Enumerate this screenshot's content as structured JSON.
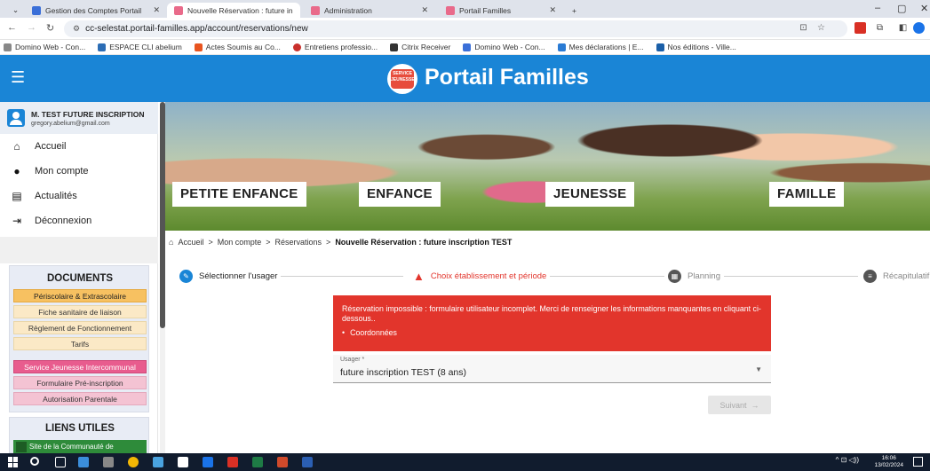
{
  "browser": {
    "tabs": [
      {
        "label": "Gestion des Comptes Portail",
        "favicon_color": "#3a6fd8",
        "active": false
      },
      {
        "label": "Nouvelle Réservation : future in",
        "favicon_color": "#e96a8a",
        "active": true
      },
      {
        "label": "Administration",
        "favicon_color": "#e96a8a",
        "active": false
      },
      {
        "label": "Portail Familles",
        "favicon_color": "#e96a8a",
        "active": false
      }
    ],
    "new_tab_label": "+",
    "url": "cc-selestat.portail-familles.app/account/reservations/new",
    "bookmarks": [
      {
        "label": "Domino Web - Con...",
        "color": "#888"
      },
      {
        "label": "ESPACE CLI abelium",
        "color": "#2c6db5"
      },
      {
        "label": "Actes Soumis au Co...",
        "color": "#e8541f"
      },
      {
        "label": "Entretiens professio...",
        "color": "#c9302c"
      },
      {
        "label": "Citrix Receiver",
        "color": "#333"
      },
      {
        "label": "Domino Web - Con...",
        "color": "#3a6fd8"
      },
      {
        "label": "Mes déclarations | E...",
        "color": "#2a7bd4"
      },
      {
        "label": "Nos éditions - Ville...",
        "color": "#1a5fa8"
      }
    ]
  },
  "app": {
    "title": "Portail Familles",
    "logo_text": "SERVICE JEUNESSE",
    "brand_color": "#1a85d6"
  },
  "sidebar": {
    "user_name": "M. TEST FUTURE INSCRIPTION",
    "user_email": "gregory.abelium@gmail.com",
    "nav": [
      {
        "label": "Accueil",
        "icon": "home-icon"
      },
      {
        "label": "Mon compte",
        "icon": "account-icon"
      },
      {
        "label": "Actualités",
        "icon": "news-icon"
      },
      {
        "label": "Déconnexion",
        "icon": "logout-icon"
      }
    ],
    "documents_title": "DOCUMENTS",
    "documents": [
      {
        "label": "Périscolaire & Extrascolaire",
        "style": "orange"
      },
      {
        "label": "Fiche sanitaire de liaison",
        "style": "cream"
      },
      {
        "label": "Règlement de Fonctionnement",
        "style": "cream"
      },
      {
        "label": "Tarifs",
        "style": "cream"
      },
      {
        "label": "Service Jeunesse Intercommunal",
        "style": "pink"
      },
      {
        "label": "Formulaire Pré-inscription",
        "style": "lpink"
      },
      {
        "label": "Autorisation Parentale",
        "style": "lpink"
      }
    ],
    "links_title": "LIENS UTILES",
    "links": [
      {
        "label": "Site de la Communauté de"
      }
    ]
  },
  "banner": {
    "labels": [
      "PETITE ENFANCE",
      "ENFANCE",
      "JEUNESSE",
      "FAMILLE"
    ]
  },
  "breadcrumb": {
    "items": [
      "Accueil",
      "Mon compte",
      "Réservations"
    ],
    "separator": ">",
    "current": "Nouvelle Réservation : future inscription TEST"
  },
  "stepper": {
    "steps": [
      {
        "label": "Sélectionner l'usager",
        "state": "done",
        "color": "#1a85d6"
      },
      {
        "label": "Choix établissement et période",
        "state": "error",
        "color": "#e2352c"
      },
      {
        "label": "Planning",
        "state": "pending",
        "color": "#555"
      },
      {
        "label": "Récapitulatif",
        "state": "pending",
        "color": "#555"
      }
    ]
  },
  "alert": {
    "message": "Réservation impossible : formulaire utilisateur incomplet. Merci de renseigner les informations manquantes en cliquant ci-dessous..",
    "items": [
      "Coordonnées"
    ],
    "color": "#e2352c"
  },
  "form": {
    "usager_label": "Usager *",
    "usager_value": "future inscription TEST (8 ans)",
    "next_label": "Suivant"
  },
  "taskbar": {
    "time": "16:06",
    "date": "13/02/2024"
  }
}
